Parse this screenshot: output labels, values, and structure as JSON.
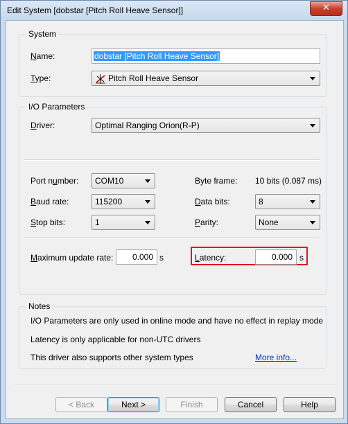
{
  "window": {
    "title": "Edit System [dobstar   [Pitch Roll Heave Sensor]]",
    "close_glyph": "✕"
  },
  "system": {
    "group_title": "System",
    "name_label": "Name:",
    "name_value": "dobstar   [Pitch Roll Heave Sensor]",
    "type_label": "Type:",
    "type_value": "Pitch Roll Heave Sensor",
    "type_icon": "pitch-roll-heave-sensor-icon"
  },
  "io": {
    "group_title": "I/O Parameters",
    "driver_label": "Driver:",
    "driver_value": "Optimal Ranging Orion(R-P)",
    "port_label": "Port number:",
    "port_value": "COM10",
    "baud_label": "Baud rate:",
    "baud_value": "115200",
    "stop_label": "Stop bits:",
    "stop_value": "1",
    "byteframe_label": "Byte frame:",
    "byteframe_value": "10 bits (0.087 ms)",
    "databits_label": "Data bits:",
    "databits_value": "8",
    "parity_label": "Parity:",
    "parity_value": "None",
    "maxrate_label": "Maximum update rate:",
    "maxrate_value": "0.000",
    "maxrate_unit": "s",
    "latency_label": "Latency:",
    "latency_value": "0.000",
    "latency_unit": "s",
    "highlight_color": "#e0141e"
  },
  "notes": {
    "group_title": "Notes",
    "line1": "I/O Parameters are only used in online mode and have no effect in replay mode",
    "line2": "Latency is only applicable for non-UTC drivers",
    "line3": "This driver also supports other system types",
    "more_info": "More info..."
  },
  "buttons": {
    "back": "< Back",
    "next": "Next >",
    "finish": "Finish",
    "cancel": "Cancel",
    "help": "Help"
  }
}
